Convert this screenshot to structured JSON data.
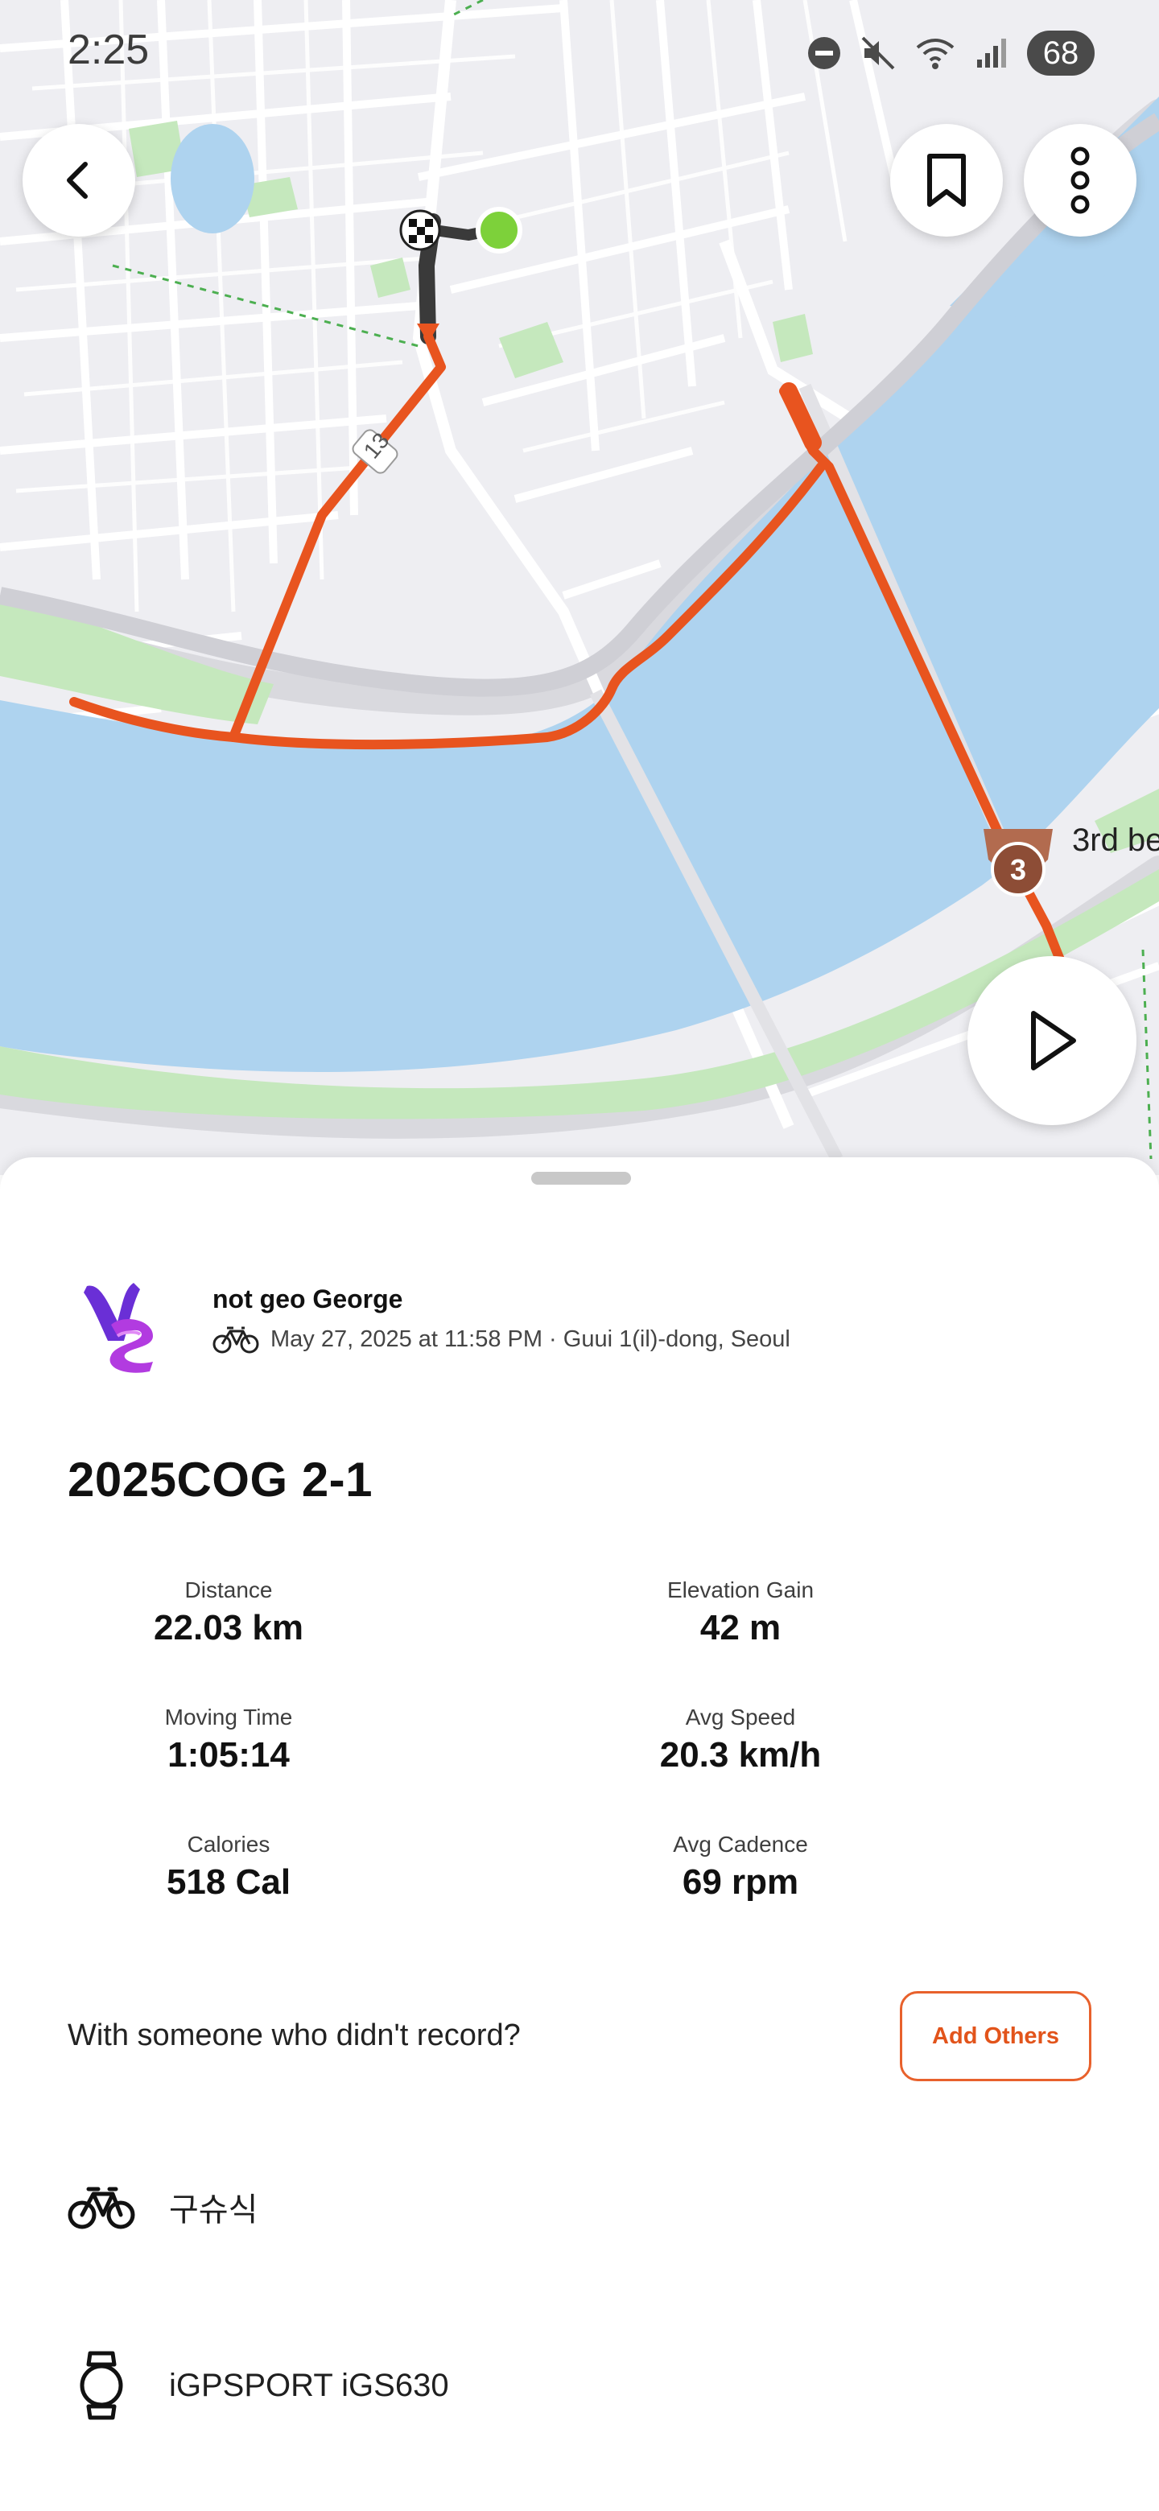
{
  "status_bar": {
    "time": "2:25",
    "battery": "68"
  },
  "map": {
    "segment_label": "3rd be",
    "road_number": "13",
    "medal_rank": "3",
    "colors": {
      "route": "#e8541f",
      "water": "#aed3ef",
      "park": "#bfe6b5",
      "land": "#eeeef2"
    }
  },
  "header_buttons": {
    "back": "back-icon",
    "bookmark": "bookmark-icon",
    "more": "more-vertical-icon",
    "play": "play-icon"
  },
  "athlete": {
    "name": "not geo George",
    "meta": "May 27, 2025 at 11:58 PM · Guui 1(il)-dong, Seoul",
    "sport_icon": "bike-icon"
  },
  "activity": {
    "title": "2025COG 2-1"
  },
  "stats": [
    {
      "label": "Distance",
      "value": "22.03 km"
    },
    {
      "label": "Elevation Gain",
      "value": "42 m"
    },
    {
      "label": "Moving Time",
      "value": "1:05:14"
    },
    {
      "label": "Avg Speed",
      "value": "20.3 km/h"
    },
    {
      "label": "Calories",
      "value": "518 Cal"
    },
    {
      "label": "Avg Cadence",
      "value": "69 rpm"
    }
  ],
  "together": {
    "question": "With someone who didn't record?",
    "button": "Add Others"
  },
  "gear": {
    "bike": "구슈식",
    "device": "iGPSPORT iGS630"
  },
  "accent": "#e8541f"
}
